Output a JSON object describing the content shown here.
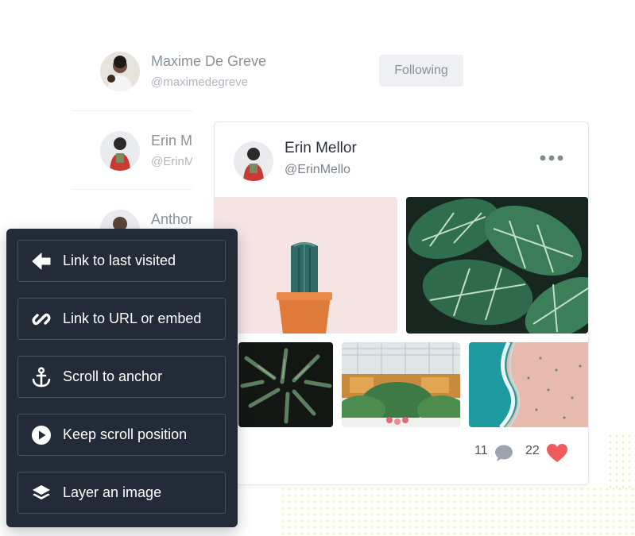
{
  "users": [
    {
      "name": "Maxime De Greve",
      "handle": "@maximedegreve",
      "avatar_icon": "person-avatar-icon"
    },
    {
      "name": "Erin Mellor",
      "handle": "@ErinMello",
      "avatar_icon": "person-avatar-icon"
    },
    {
      "name": "Anthony",
      "handle": "",
      "avatar_icon": "person-avatar-icon"
    }
  ],
  "follow_button": {
    "label": "Following"
  },
  "post": {
    "author_name": "Erin Mellor",
    "author_handle": "@ErinMello",
    "more_icon": "more-dots-icon",
    "photos": [
      {
        "subject": "cactus",
        "icon": "cactus-photo"
      },
      {
        "subject": "leaves",
        "icon": "leaves-photo"
      },
      {
        "subject": "dark-plant",
        "icon": "plant-photo"
      },
      {
        "subject": "greenhouse",
        "icon": "greenhouse-photo"
      },
      {
        "subject": "beach",
        "icon": "beach-photo"
      }
    ],
    "comments_count": "11",
    "likes_count": "22",
    "comment_icon": "comment-bubble-icon",
    "like_icon": "heart-icon"
  },
  "menu": {
    "items": [
      {
        "label": "Link to last visited",
        "icon": "arrow-left-icon"
      },
      {
        "label": "Link to URL or embed",
        "icon": "link-icon"
      },
      {
        "label": "Scroll to anchor",
        "icon": "anchor-icon"
      },
      {
        "label": "Keep scroll position",
        "icon": "play-circle-icon"
      },
      {
        "label": "Layer an image",
        "icon": "layers-icon"
      }
    ]
  },
  "colors": {
    "menu_bg": "#232b39",
    "menu_border": "#48505d",
    "heart": "#ef5a5f",
    "comment": "#9ca4ad",
    "text_dark": "#2a313c",
    "text_muted": "#8a919b"
  }
}
